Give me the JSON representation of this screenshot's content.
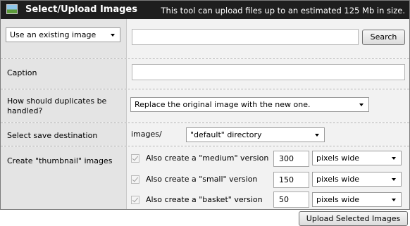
{
  "header": {
    "title": "Select/Upload Images",
    "note": "This tool can upload files up to an estimated 125 Mb in size.",
    "icon": "image-icon"
  },
  "source_row": {
    "select_value": "Use an existing image",
    "search_value": "",
    "search_button": "Search"
  },
  "caption_row": {
    "label": "Caption",
    "value": ""
  },
  "duplicates_row": {
    "label": "How should duplicates be handled?",
    "select_value": "Replace the original image with the new one."
  },
  "destination_row": {
    "label": "Select save destination",
    "prefix": "images/",
    "select_value": "\"default\" directory"
  },
  "thumbnail_row": {
    "label": "Create \"thumbnail\" images",
    "items": [
      {
        "label": "Also create a \"medium\" version",
        "checked": true,
        "size": "300",
        "unit": "pixels wide"
      },
      {
        "label": "Also create a \"small\" version",
        "checked": true,
        "size": "150",
        "unit": "pixels wide"
      },
      {
        "label": "Also create a \"basket\" version",
        "checked": true,
        "size": "50",
        "unit": "pixels wide"
      }
    ]
  },
  "footer": {
    "upload_button": "Upload Selected Images"
  }
}
